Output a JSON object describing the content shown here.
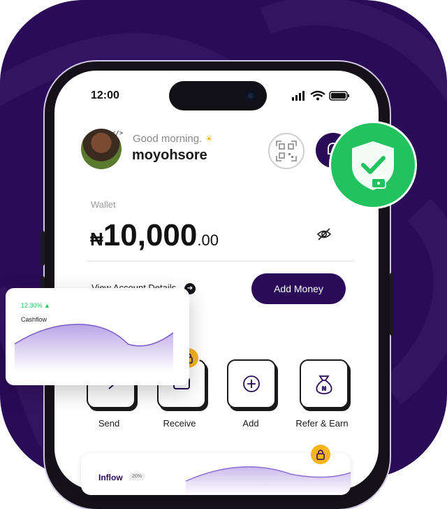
{
  "status_bar": {
    "time": "12:00"
  },
  "header": {
    "greeting": "Good morning.",
    "username": "moyohsore",
    "avatar_badge": "</>"
  },
  "wallet": {
    "label": "Wallet",
    "currency_symbol": "₦",
    "amount_main": "10,000",
    "amount_decimal": ".00"
  },
  "account": {
    "view_details": "View Account Details",
    "add_money": "Add Money"
  },
  "actions": [
    {
      "label": "Send",
      "icon": "send-icon"
    },
    {
      "label": "Receive",
      "icon": "receive-icon"
    },
    {
      "label": "Add",
      "icon": "plus-icon"
    },
    {
      "label": "Refer & Earn",
      "icon": "naira-bag-icon"
    }
  ],
  "cashflow": {
    "percent": "12.30%",
    "title": "Cashflow"
  },
  "inflow": {
    "label": "Inflow",
    "pill": "20%"
  },
  "colors": {
    "brand": "#2a0b57",
    "success": "#22c35e",
    "badge": "#f6b421"
  }
}
